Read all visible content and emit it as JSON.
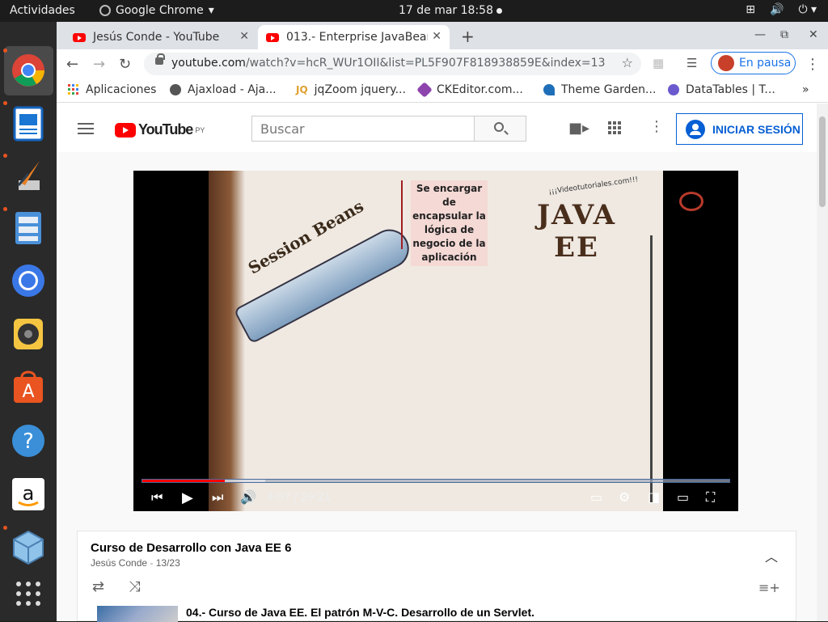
{
  "topbar": {
    "activities": "Actividades",
    "app_name": "Google Chrome",
    "clock": "17 de mar  18:58"
  },
  "browser": {
    "tabs": [
      {
        "label": "Jesús Conde - YouTube"
      },
      {
        "label": "013.- Enterprise JavaBear"
      }
    ],
    "url_host": "youtube.com",
    "url_path": "/watch?v=hcR_WUr1OII&list=PL5F907F818938859E&index=13",
    "paused_label": "En pausa",
    "bookmarks": [
      {
        "label": "Aplicaciones"
      },
      {
        "label": "Ajaxload - Aja..."
      },
      {
        "label": "jqZoom jquery..."
      },
      {
        "label": "CKEditor.com..."
      },
      {
        "label": "Theme Garden..."
      },
      {
        "label": "DataTables | T..."
      }
    ]
  },
  "youtube": {
    "logo_region": "PY",
    "search_placeholder": "Buscar",
    "signin_label": "INICIAR SESIÓN",
    "video": {
      "slide_label": "Session Beans",
      "slide_note": "Se encargar de encapsular la lógica de negocio de la aplicación",
      "brand": "JAVA EE",
      "brand_sub": "¡¡¡Videotutoriales.com!!!",
      "time_current": "4:07",
      "time_total": "29:21",
      "time_text": "4:07 / 29:21",
      "played_fraction": 0.14,
      "buffered_fraction": 0.21
    },
    "playlist": {
      "title": "Curso de Desarrollo con Java EE 6",
      "author": "Jesús Conde",
      "position": "13/23",
      "items": [
        {
          "title": "04.- Curso de Java EE. El patrón M-V-C. Desarrollo de un Servlet."
        }
      ]
    }
  }
}
